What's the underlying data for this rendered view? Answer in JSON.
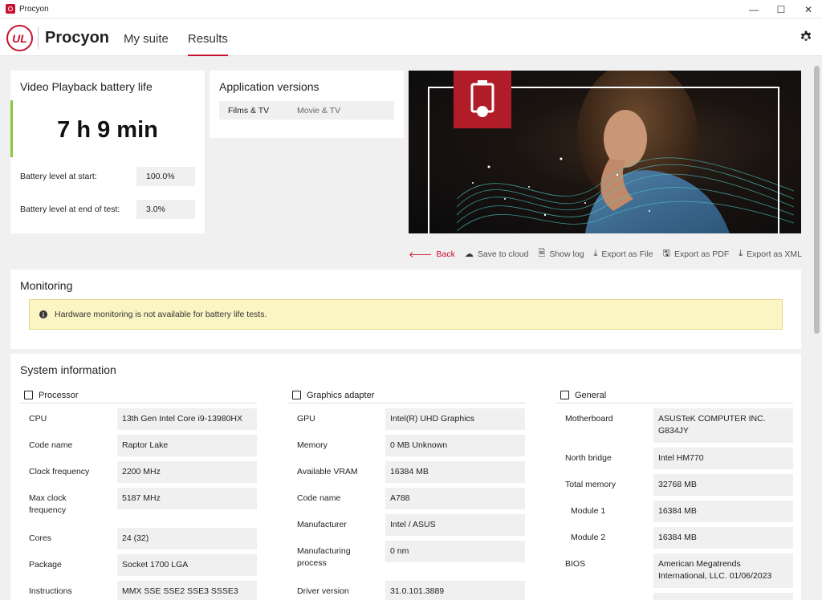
{
  "window": {
    "title": "Procyon",
    "controls": [
      "—",
      "☐",
      "✕"
    ]
  },
  "header": {
    "logo_text": "UL",
    "brand": "Procyon",
    "nav": [
      {
        "label": "My suite",
        "active": false
      },
      {
        "label": "Results",
        "active": true
      }
    ]
  },
  "result": {
    "title": "Video Playback battery life",
    "score": "7 h 9 min",
    "battery_start_label": "Battery level at start:",
    "battery_start_value": "100.0%",
    "battery_end_label": "Battery level at end of test:",
    "battery_end_value": "3.0%"
  },
  "versions": {
    "title": "Application versions",
    "app": "Films & TV",
    "version": "Movie & TV"
  },
  "actions": {
    "back": "Back",
    "save_cloud": "Save to cloud",
    "show_log": "Show log",
    "export_file": "Export as File",
    "export_pdf": "Export as PDF",
    "export_xml": "Export as XML"
  },
  "monitoring": {
    "title": "Monitoring",
    "alert": "Hardware monitoring is not available for battery life tests."
  },
  "sysinfo": {
    "title": "System information",
    "processor": {
      "title": "Processor",
      "rows": [
        {
          "k": "CPU",
          "v": "13th Gen Intel Core i9-13980HX"
        },
        {
          "k": "Code name",
          "v": "Raptor Lake"
        },
        {
          "k": "Clock frequency",
          "v": "2200 MHz"
        },
        {
          "k": "Max clock frequency",
          "v": "5187 MHz"
        },
        {
          "k": "Cores",
          "v": "24 (32)"
        },
        {
          "k": "Package",
          "v": "Socket 1700 LGA"
        },
        {
          "k": "Instructions",
          "v": "MMX SSE SSE2 SSE3 SSSE3 SSE41"
        }
      ]
    },
    "graphics": {
      "title": "Graphics adapter",
      "rows": [
        {
          "k": "GPU",
          "v": "Intel(R) UHD Graphics"
        },
        {
          "k": "Memory",
          "v": "0 MB Unknown"
        },
        {
          "k": "Available VRAM",
          "v": "16384 MB"
        },
        {
          "k": "Code name",
          "v": "A788"
        },
        {
          "k": "Manufacturer",
          "v": "Intel / ASUS"
        },
        {
          "k": "Manufacturing process",
          "v": "0 nm"
        },
        {
          "k": "Driver version",
          "v": "31.0.101.3889"
        }
      ]
    },
    "general": {
      "title": "General",
      "rows": [
        {
          "k": "Motherboard",
          "v": "ASUSTeK COMPUTER INC. G834JY"
        },
        {
          "k": "North bridge",
          "v": "Intel HM770"
        },
        {
          "k": "Total memory",
          "v": "32768 MB"
        },
        {
          "k": "Module 1",
          "v": "16384 MB"
        },
        {
          "k": "Module 2",
          "v": "16384 MB"
        },
        {
          "k": "BIOS",
          "v": "American Megatrends International, LLC. 01/06/2023"
        }
      ]
    }
  },
  "colors": {
    "accent": "#c8102e",
    "score_bar": "#8cc63f",
    "alert_bg": "#fbf5c4"
  }
}
